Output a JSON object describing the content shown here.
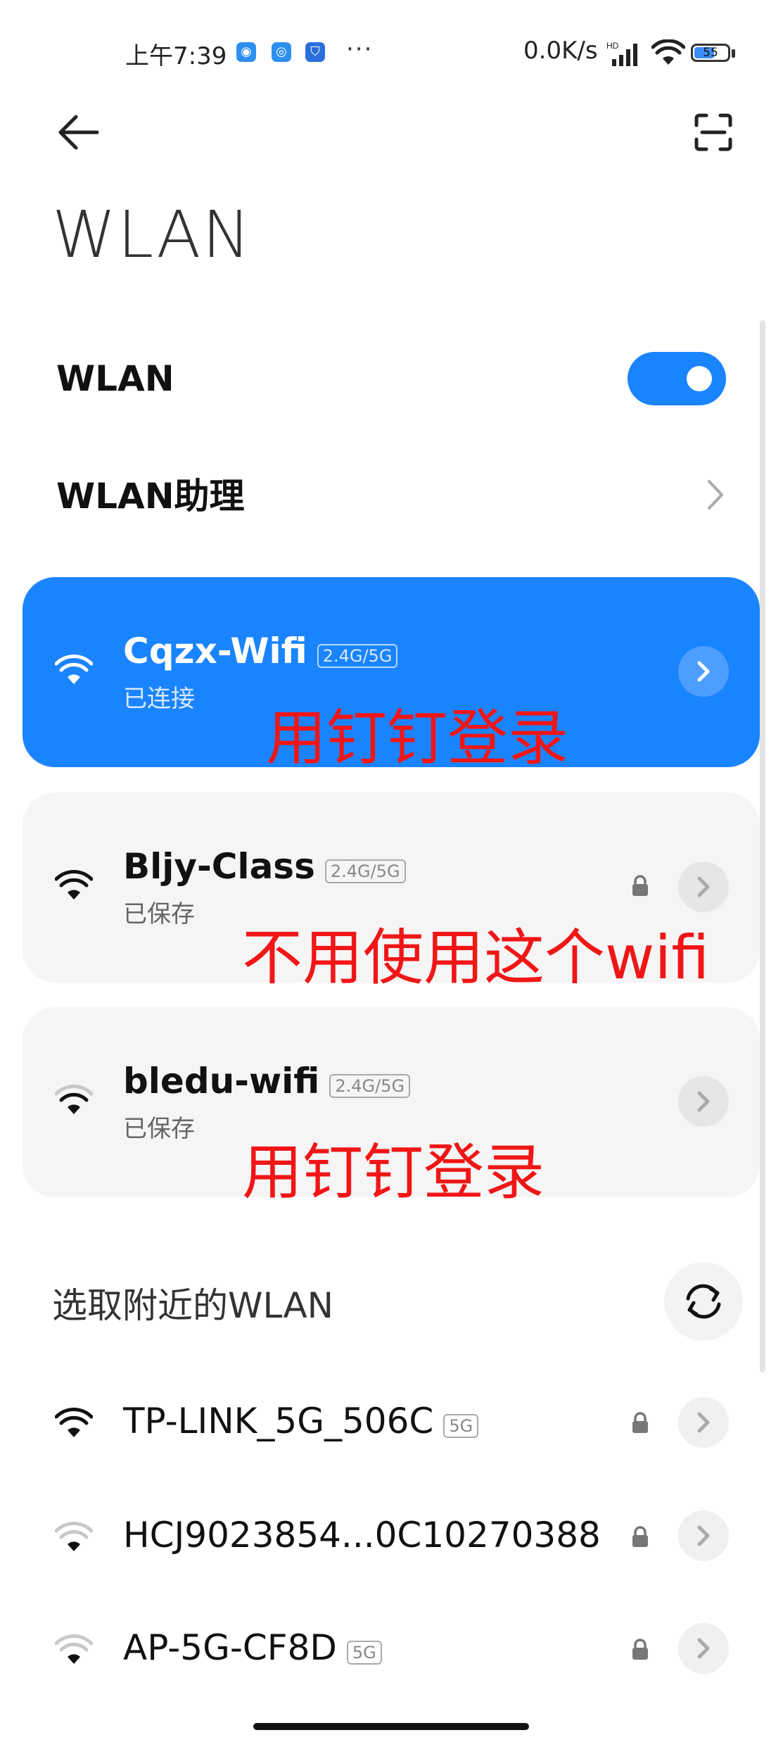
{
  "status_bar": {
    "time": "上午7:39",
    "more": "···",
    "net_speed": "0.0K/s",
    "network_type": "HD",
    "battery": "55"
  },
  "page": {
    "title": "WLAN"
  },
  "settings": {
    "wlan_label": "WLAN",
    "wlan_enabled": true,
    "assistant_label": "WLAN助理"
  },
  "saved_networks": [
    {
      "name": "Cqzx-Wifi",
      "band": "2.4G/5G",
      "status": "已连接",
      "annotation": "用钉钉登录"
    },
    {
      "name": "Bljy-Class",
      "band": "2.4G/5G",
      "status": "已保存",
      "annotation": "不用使用这个wifi"
    },
    {
      "name": "bledu-wifi",
      "band": "2.4G/5G",
      "status": "已保存",
      "annotation": "用钉钉登录"
    }
  ],
  "nearby": {
    "title": "选取附近的WLAN",
    "networks": [
      {
        "name": "TP-LINK_5G_506C",
        "band": "5G"
      },
      {
        "name": "HCJ9023854...0C10270388",
        "band": ""
      },
      {
        "name": "AP-5G-CF8D",
        "band": "5G"
      }
    ]
  },
  "colors": {
    "accent": "#1a84ff",
    "annotation": "#f01616"
  }
}
